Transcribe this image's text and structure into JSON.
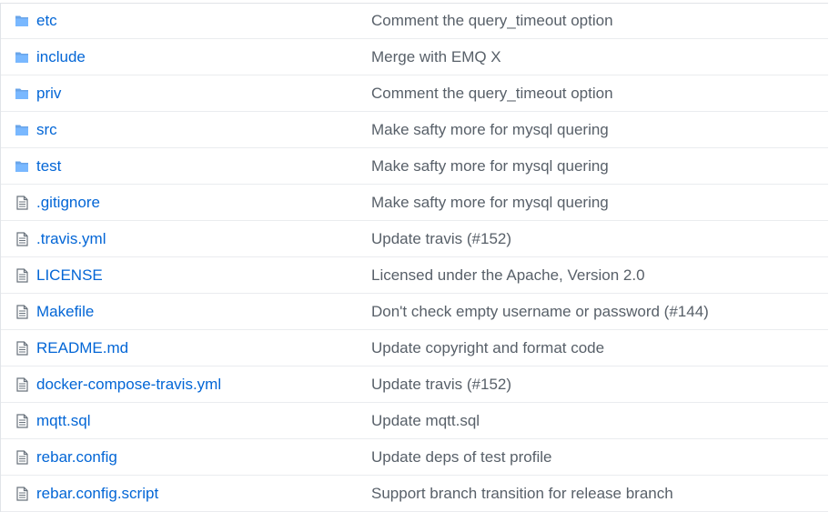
{
  "colors": {
    "link": "#0366d6",
    "message": "#586069",
    "folder_icon": "#79b8ff",
    "file_icon": "#6a737d",
    "border": "#eaecef"
  },
  "files": [
    {
      "name": "etc",
      "type": "folder",
      "icon": "folder-icon",
      "message": "Comment the query_timeout option"
    },
    {
      "name": "include",
      "type": "folder",
      "icon": "folder-icon",
      "message": "Merge with EMQ X"
    },
    {
      "name": "priv",
      "type": "folder",
      "icon": "folder-icon",
      "message": "Comment the query_timeout option"
    },
    {
      "name": "src",
      "type": "folder",
      "icon": "folder-icon",
      "message": "Make safty more for mysql quering"
    },
    {
      "name": "test",
      "type": "folder",
      "icon": "folder-icon",
      "message": "Make safty more for mysql quering"
    },
    {
      "name": ".gitignore",
      "type": "file",
      "icon": "file-icon",
      "message": "Make safty more for mysql quering"
    },
    {
      "name": ".travis.yml",
      "type": "file",
      "icon": "file-icon",
      "message": "Update travis (#152)"
    },
    {
      "name": "LICENSE",
      "type": "file",
      "icon": "file-icon",
      "message": "Licensed under the Apache, Version 2.0"
    },
    {
      "name": "Makefile",
      "type": "file",
      "icon": "file-icon",
      "message": "Don't check empty username or password (#144)"
    },
    {
      "name": "README.md",
      "type": "file",
      "icon": "file-icon",
      "message": "Update copyright and format code"
    },
    {
      "name": "docker-compose-travis.yml",
      "type": "file",
      "icon": "file-icon",
      "message": "Update travis (#152)"
    },
    {
      "name": "mqtt.sql",
      "type": "file",
      "icon": "file-icon",
      "message": "Update mqtt.sql"
    },
    {
      "name": "rebar.config",
      "type": "file",
      "icon": "file-icon",
      "message": "Update deps of test profile"
    },
    {
      "name": "rebar.config.script",
      "type": "file",
      "icon": "file-icon",
      "message": "Support branch transition for release branch"
    }
  ]
}
